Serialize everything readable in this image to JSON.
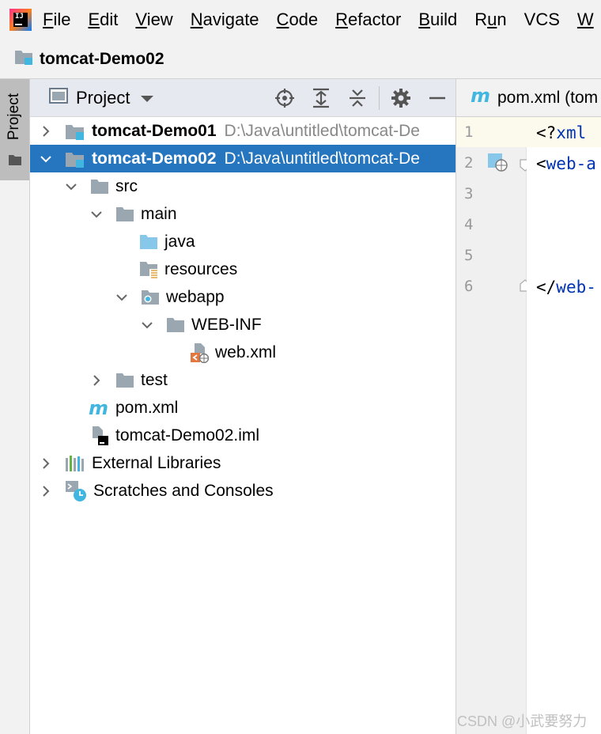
{
  "menubar": {
    "items": [
      "File",
      "Edit",
      "View",
      "Navigate",
      "Code",
      "Refactor",
      "Build",
      "Run",
      "VCS",
      "W"
    ],
    "mnemonics": [
      "F",
      "E",
      "V",
      "N",
      "C",
      "R",
      "B",
      "u",
      "",
      "W"
    ]
  },
  "navbar": {
    "project_name": "tomcat-Demo02"
  },
  "side_strip": {
    "tab_label": "Project"
  },
  "panel": {
    "title": "Project"
  },
  "tree": [
    {
      "label": "tomcat-Demo01",
      "path": "D:\\Java\\untitled\\tomcat-De",
      "expanded": false,
      "selected": false,
      "bold": true,
      "icon": "module-folder-icon"
    },
    {
      "label": "tomcat-Demo02",
      "path": "D:\\Java\\untitled\\tomcat-De",
      "expanded": true,
      "selected": true,
      "bold": true,
      "icon": "module-folder-icon"
    },
    {
      "label": "src",
      "expanded": true,
      "icon": "folder-icon"
    },
    {
      "label": "main",
      "expanded": true,
      "icon": "folder-icon"
    },
    {
      "label": "java",
      "icon": "source-folder-icon"
    },
    {
      "label": "resources",
      "icon": "resources-folder-icon"
    },
    {
      "label": "webapp",
      "expanded": true,
      "icon": "web-folder-icon"
    },
    {
      "label": "WEB-INF",
      "expanded": true,
      "icon": "folder-icon"
    },
    {
      "label": "web.xml",
      "icon": "web-xml-file-icon"
    },
    {
      "label": "test",
      "expanded": false,
      "icon": "folder-icon"
    },
    {
      "label": "pom.xml",
      "icon": "maven-icon"
    },
    {
      "label": "tomcat-Demo02.iml",
      "icon": "iml-file-icon"
    },
    {
      "label": "External Libraries",
      "expanded": false,
      "icon": "libraries-icon"
    },
    {
      "label": "Scratches and Consoles",
      "expanded": false,
      "icon": "scratches-icon"
    }
  ],
  "editor": {
    "tab_label": "pom.xml (tom",
    "line_numbers": [
      "1",
      "2",
      "3",
      "4",
      "5",
      "6"
    ],
    "lines": [
      {
        "punct": "<?",
        "tag": "xml"
      },
      {
        "punct": "<",
        "tag": "web-a"
      },
      {
        "punct": "",
        "tag": ""
      },
      {
        "punct": "",
        "tag": ""
      },
      {
        "punct": "",
        "tag": ""
      },
      {
        "punct": "</",
        "tag": "web-"
      }
    ]
  },
  "watermark": "CSDN @小武要努力",
  "colors": {
    "selection": "#2675bf",
    "tag": "#0033b3",
    "header_bg": "#e6e9f0",
    "chrome_bg": "#f2f2f2"
  }
}
